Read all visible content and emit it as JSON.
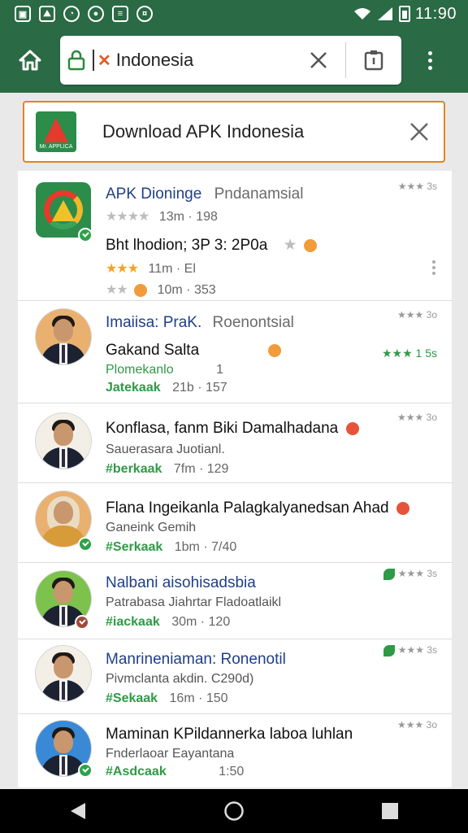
{
  "status_bar": {
    "time": "11:90",
    "icons": [
      "gallery-icon",
      "image-icon",
      "circle-icon",
      "camera-icon",
      "notes-icon",
      "wallet-icon",
      "wifi-icon",
      "signal-icon",
      "battery-icon"
    ]
  },
  "toolbar": {
    "url_text": "Indonesia",
    "icons": [
      "home-icon",
      "lock-icon",
      "clear-icon",
      "tab-icon",
      "more-vert-icon"
    ]
  },
  "suggestion": {
    "text": "Download APK Indonesia",
    "logo_label": "Mr. APPLICA"
  },
  "results": [
    {
      "title_main": "APK Dioninge",
      "title_extra": "Pndanamsial",
      "right_tag": "★★★ 3s",
      "meta1_label": "13m · 198",
      "line2": "Bht lhodion; 3P 3: 2P0a",
      "meta2_label": "11m · El",
      "meta3_label": "10m · 353"
    },
    {
      "title_main": "Imaiisa: PraK.",
      "title_extra": "Roenontsial",
      "right_tag": "★★★ 3o",
      "line2": "Gakand Salta",
      "rating_tag": "★★★ 1 5s",
      "sub": "Plomekanlo",
      "sub_num": "1",
      "meta_tag": "Jatekaak",
      "meta_label": "21b · 157"
    },
    {
      "line1": "Konflasa, fanm Biki Damalhadana",
      "right_tag": "★★★ 3o",
      "sub": "Sauerasara Juotianl.",
      "meta_tag": "#berkaak",
      "meta_label": "7fm · 129"
    },
    {
      "line1": "Flana Ingeikanla Palagkalyanedsan Ahad",
      "sub": "Ganeink Gemih",
      "meta_tag": "#Serkaak",
      "meta_label": "1bm · 7/40"
    },
    {
      "title_main": "Nalbani aisohisadsbia",
      "right_tag": "★★★ 3s",
      "sub": "Patrabasa Jiahrtar Fladoatlaikl",
      "meta_tag": "#iackaak",
      "meta_label": "30m · 120"
    },
    {
      "title_main": "Manrineniaman: Ronenotil",
      "right_tag": "★★★ 3s",
      "sub": "Pivmclanta akdin. C290d)",
      "meta_tag": "#Sekaak",
      "meta_label": "16m · 150"
    },
    {
      "line1": "Maminan KPildannerka laboa luhlan",
      "right_tag": "★★★ 3o",
      "sub": "Fnderlaoar Eayantana",
      "meta_tag": "#Asdcaak",
      "meta_label": "1:50"
    }
  ],
  "nav": {
    "icons": [
      "back-icon",
      "home-nav-icon",
      "recents-icon"
    ]
  },
  "colors": {
    "app_bar": "#2a6a44",
    "accent_orange": "#e5831f",
    "link_blue": "#1f3f8a",
    "tag_green": "#2e9a46"
  }
}
